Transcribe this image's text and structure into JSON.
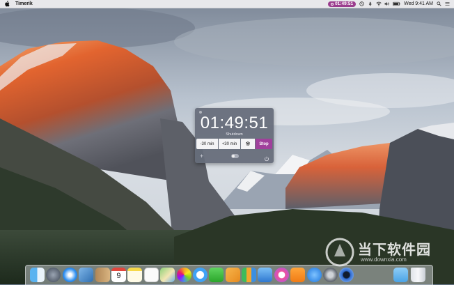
{
  "menubar": {
    "app_name": "Timerik",
    "timer_display": "01:49:51",
    "clock": "Wed 9:41 AM",
    "icons": [
      "apple-icon",
      "timer-icon",
      "time-machine-icon",
      "bluetooth-icon",
      "wifi-icon",
      "volume-icon",
      "battery-icon",
      "search-icon",
      "list-icon"
    ]
  },
  "timer_popup": {
    "time": "01:49:51",
    "subtitle": "Shutdown",
    "buttons": {
      "minus": "-30 min",
      "plus": "+30 min",
      "stop": "Stop"
    },
    "icons": [
      "gear-icon",
      "add-icon",
      "toggle-switch",
      "power-icon"
    ],
    "accent_color": "#a0409c"
  },
  "dock": {
    "calendar_day": "9",
    "apps": [
      "finder",
      "launchpad",
      "safari",
      "preview",
      "contacts",
      "calendar",
      "notes",
      "reminders",
      "maps",
      "photos",
      "messages",
      "facetime",
      "pages",
      "numbers",
      "keynote",
      "itunes",
      "ibooks",
      "app-store",
      "system-preferences",
      "quicktime",
      "downloads",
      "trash"
    ]
  },
  "watermark": {
    "title": "当下软件园",
    "url": "www.downxia.com"
  }
}
